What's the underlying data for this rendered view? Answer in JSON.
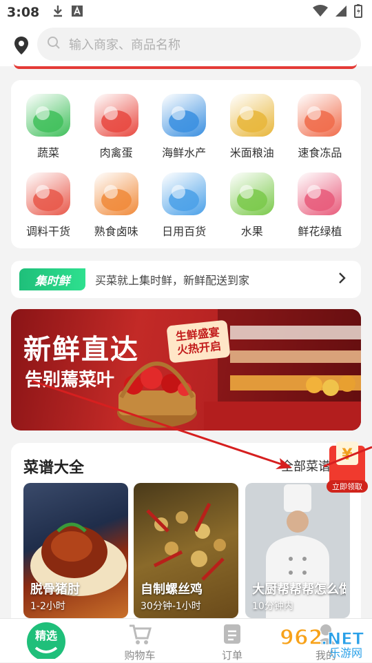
{
  "status": {
    "time": "3:08"
  },
  "search": {
    "placeholder": "输入商家、商品名称"
  },
  "categories": [
    {
      "label": "蔬菜",
      "icon": "vegetables-icon",
      "color": "#3fbf5a"
    },
    {
      "label": "肉禽蛋",
      "icon": "meat-icon",
      "color": "#e8483f"
    },
    {
      "label": "海鲜水产",
      "icon": "seafood-icon",
      "color": "#3a8fe0"
    },
    {
      "label": "米面粮油",
      "icon": "grain-oil-icon",
      "color": "#e8b63a"
    },
    {
      "label": "速食冻品",
      "icon": "frozen-food-icon",
      "color": "#f06b4a"
    },
    {
      "label": "调料干货",
      "icon": "seasoning-icon",
      "color": "#e8584a"
    },
    {
      "label": "熟食卤味",
      "icon": "cooked-food-icon",
      "color": "#f08a3a"
    },
    {
      "label": "日用百货",
      "icon": "daily-goods-icon",
      "color": "#4aa0e8"
    },
    {
      "label": "水果",
      "icon": "fruit-icon",
      "color": "#7ac94a"
    },
    {
      "label": "鲜花绿植",
      "icon": "flowers-icon",
      "color": "#e85a7a"
    }
  ],
  "promo": {
    "logo": "集时鲜",
    "text": "买菜就上集时鲜，新鲜配送到家"
  },
  "banner": {
    "headline": "新鲜直达",
    "subline": "告别蔫菜叶",
    "badge_line1": "生鲜盛宴",
    "badge_line2": "火热开启"
  },
  "recipes": {
    "title": "菜谱大全",
    "more": "全部菜谱",
    "items": [
      {
        "name": "脱骨猪肘",
        "time": "1-2小时"
      },
      {
        "name": "自制螺丝鸡",
        "time": "30分钟-1小时"
      },
      {
        "name": "大厨帮帮帮怎么做",
        "time": "10分钟内"
      }
    ]
  },
  "redpack": {
    "symbol": "¥",
    "label": "立即领取"
  },
  "tabs": [
    {
      "label": "精选"
    },
    {
      "label": "购物车"
    },
    {
      "label": "订单"
    },
    {
      "label": "我的"
    }
  ],
  "watermark": {
    "text1": "962",
    "text2": ".NET",
    "text3": "乐游网"
  },
  "colors": {
    "accent": "#1fbf7a",
    "red": "#e43a36"
  }
}
